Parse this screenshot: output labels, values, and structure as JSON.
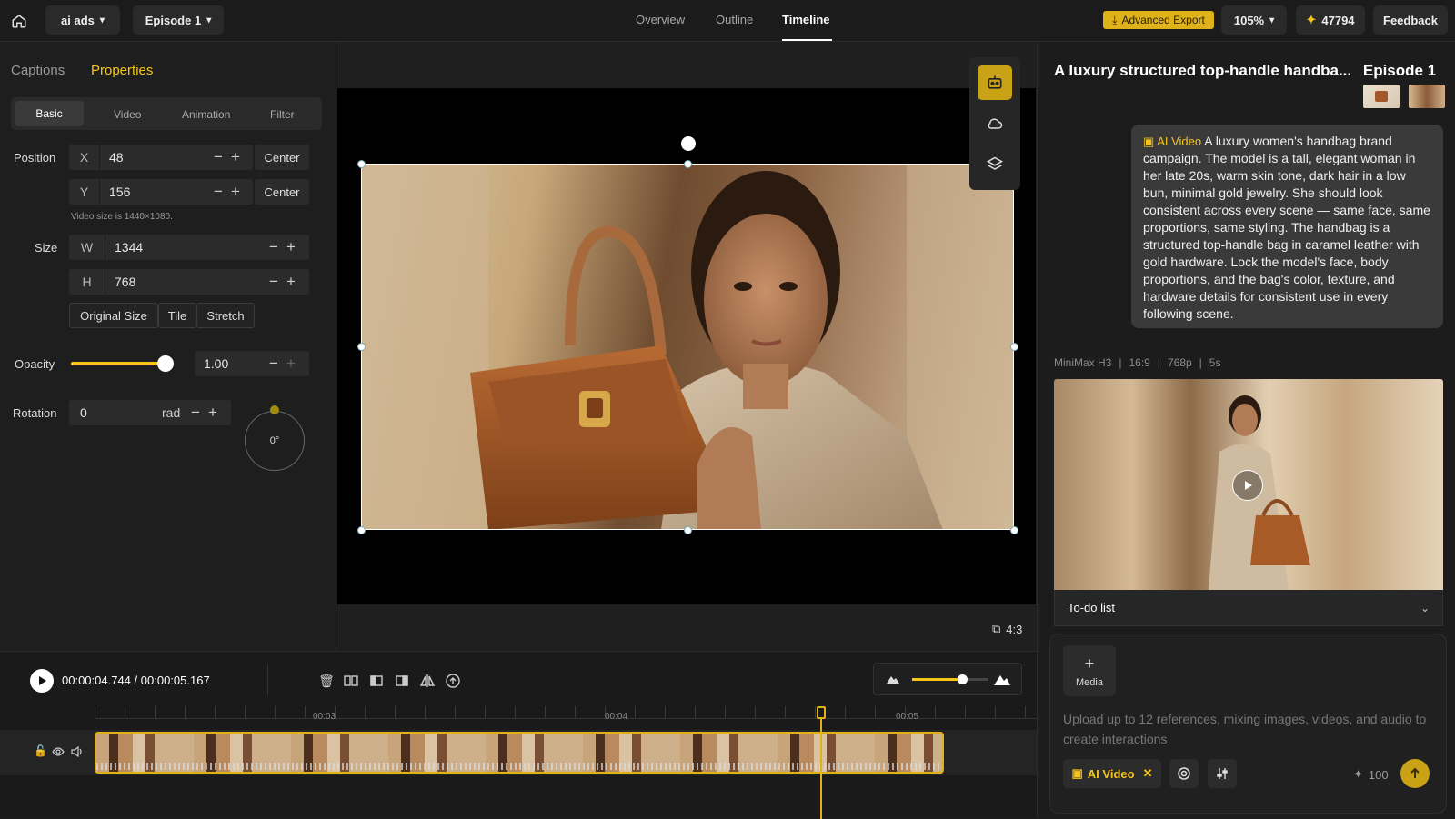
{
  "topbar": {
    "project": "ai ads",
    "episode": "Episode 1",
    "tabs": [
      "Overview",
      "Outline",
      "Timeline"
    ],
    "active_tab": "Timeline",
    "export_label": "Advanced Export",
    "zoom": "105%",
    "credits": "47794",
    "feedback": "Feedback"
  },
  "left": {
    "tabs": [
      "Captions",
      "Properties"
    ],
    "active_tab": "Properties",
    "subtabs": [
      "Basic",
      "Video",
      "Animation",
      "Filter"
    ],
    "position_label": "Position",
    "x_label": "X",
    "x_value": "48",
    "y_label": "Y",
    "y_value": "156",
    "center_label": "Center",
    "video_size_note": "Video size is 1440×1080.",
    "size_label": "Size",
    "w_label": "W",
    "w_value": "1344",
    "h_label": "H",
    "h_value": "768",
    "fit_buttons": [
      "Original Size",
      "Tile",
      "Stretch"
    ],
    "opacity_label": "Opacity",
    "opacity_value": "1.00",
    "opacity_level": 1.0,
    "rotation_label": "Rotation",
    "rotation_value": "0",
    "rotation_unit": "rad",
    "rotation_dial": "0°"
  },
  "canvas": {
    "aspect": "4:3"
  },
  "timeline": {
    "current_time": "00:00:04.744",
    "total_time": "00:00:05.167",
    "ticks": [
      "00:03",
      "00:04",
      "00:05"
    ],
    "zoom_level": 0.65
  },
  "right": {
    "title": "A luxury structured top-handle handba...",
    "episode": "Episode 1",
    "ai_video_tag": "AI Video",
    "prompt": "A luxury women's handbag brand campaign. The model is a tall, elegant woman in her late 20s, warm skin tone, dark hair in a low bun, minimal gold jewelry. She should look consistent across every scene — same face, same proportions, same styling. The handbag is a structured top-handle bag in caramel leather with gold hardware. Lock the model's face, body proportions, and the bag's color, texture, and hardware details for consistent use in every following scene.",
    "meta": [
      "MiniMax H3",
      "16:9",
      "768p",
      "5s"
    ],
    "todo": "To-do list",
    "media_label": "Media",
    "placeholder": "Upload up to 12 references, mixing images, videos, and audio to create interactions",
    "chip_label": "AI Video",
    "cost": "100"
  },
  "colors": {
    "accent": "#f5c518",
    "selection": "#9fd4e8"
  }
}
